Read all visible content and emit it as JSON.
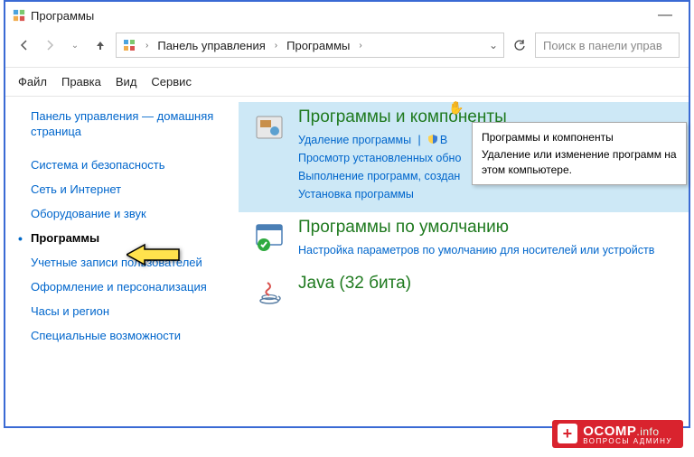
{
  "window": {
    "title": "Программы"
  },
  "breadcrumbs": {
    "root": "Панель управления",
    "section": "Программы"
  },
  "search": {
    "placeholder": "Поиск в панели управ"
  },
  "menubar": {
    "file": "Файл",
    "edit": "Правка",
    "view": "Вид",
    "tools": "Сервис"
  },
  "sidebar": {
    "home": "Панель управления — домашняя страница",
    "items": [
      "Система и безопасность",
      "Сеть и Интернет",
      "Оборудование и звук",
      "Программы",
      "Учетные записи пользователей",
      "Оформление и персонализация",
      "Часы и регион",
      "Специальные возможности"
    ],
    "activeIndex": 3
  },
  "categories": {
    "programs_features": {
      "title": "Программы и компоненты",
      "links": {
        "uninstall": "Удаление программы",
        "features": "В",
        "updates": "Просмотр установленных обно",
        "compat": "Выполнение программ, создан",
        "install": "Установка программы"
      }
    },
    "default_programs": {
      "title": "Программы по умолчанию",
      "link": "Настройка параметров по умолчанию для носителей или устройств"
    },
    "java": {
      "title": "Java (32 бита)"
    }
  },
  "tooltip": {
    "title": "Программы и компоненты",
    "body": "Удаление или изменение программ на этом компьютере."
  },
  "watermark": {
    "main": "OCOMP",
    "suffix": ".info",
    "sub": "ВОПРОСЫ АДМИНУ"
  }
}
